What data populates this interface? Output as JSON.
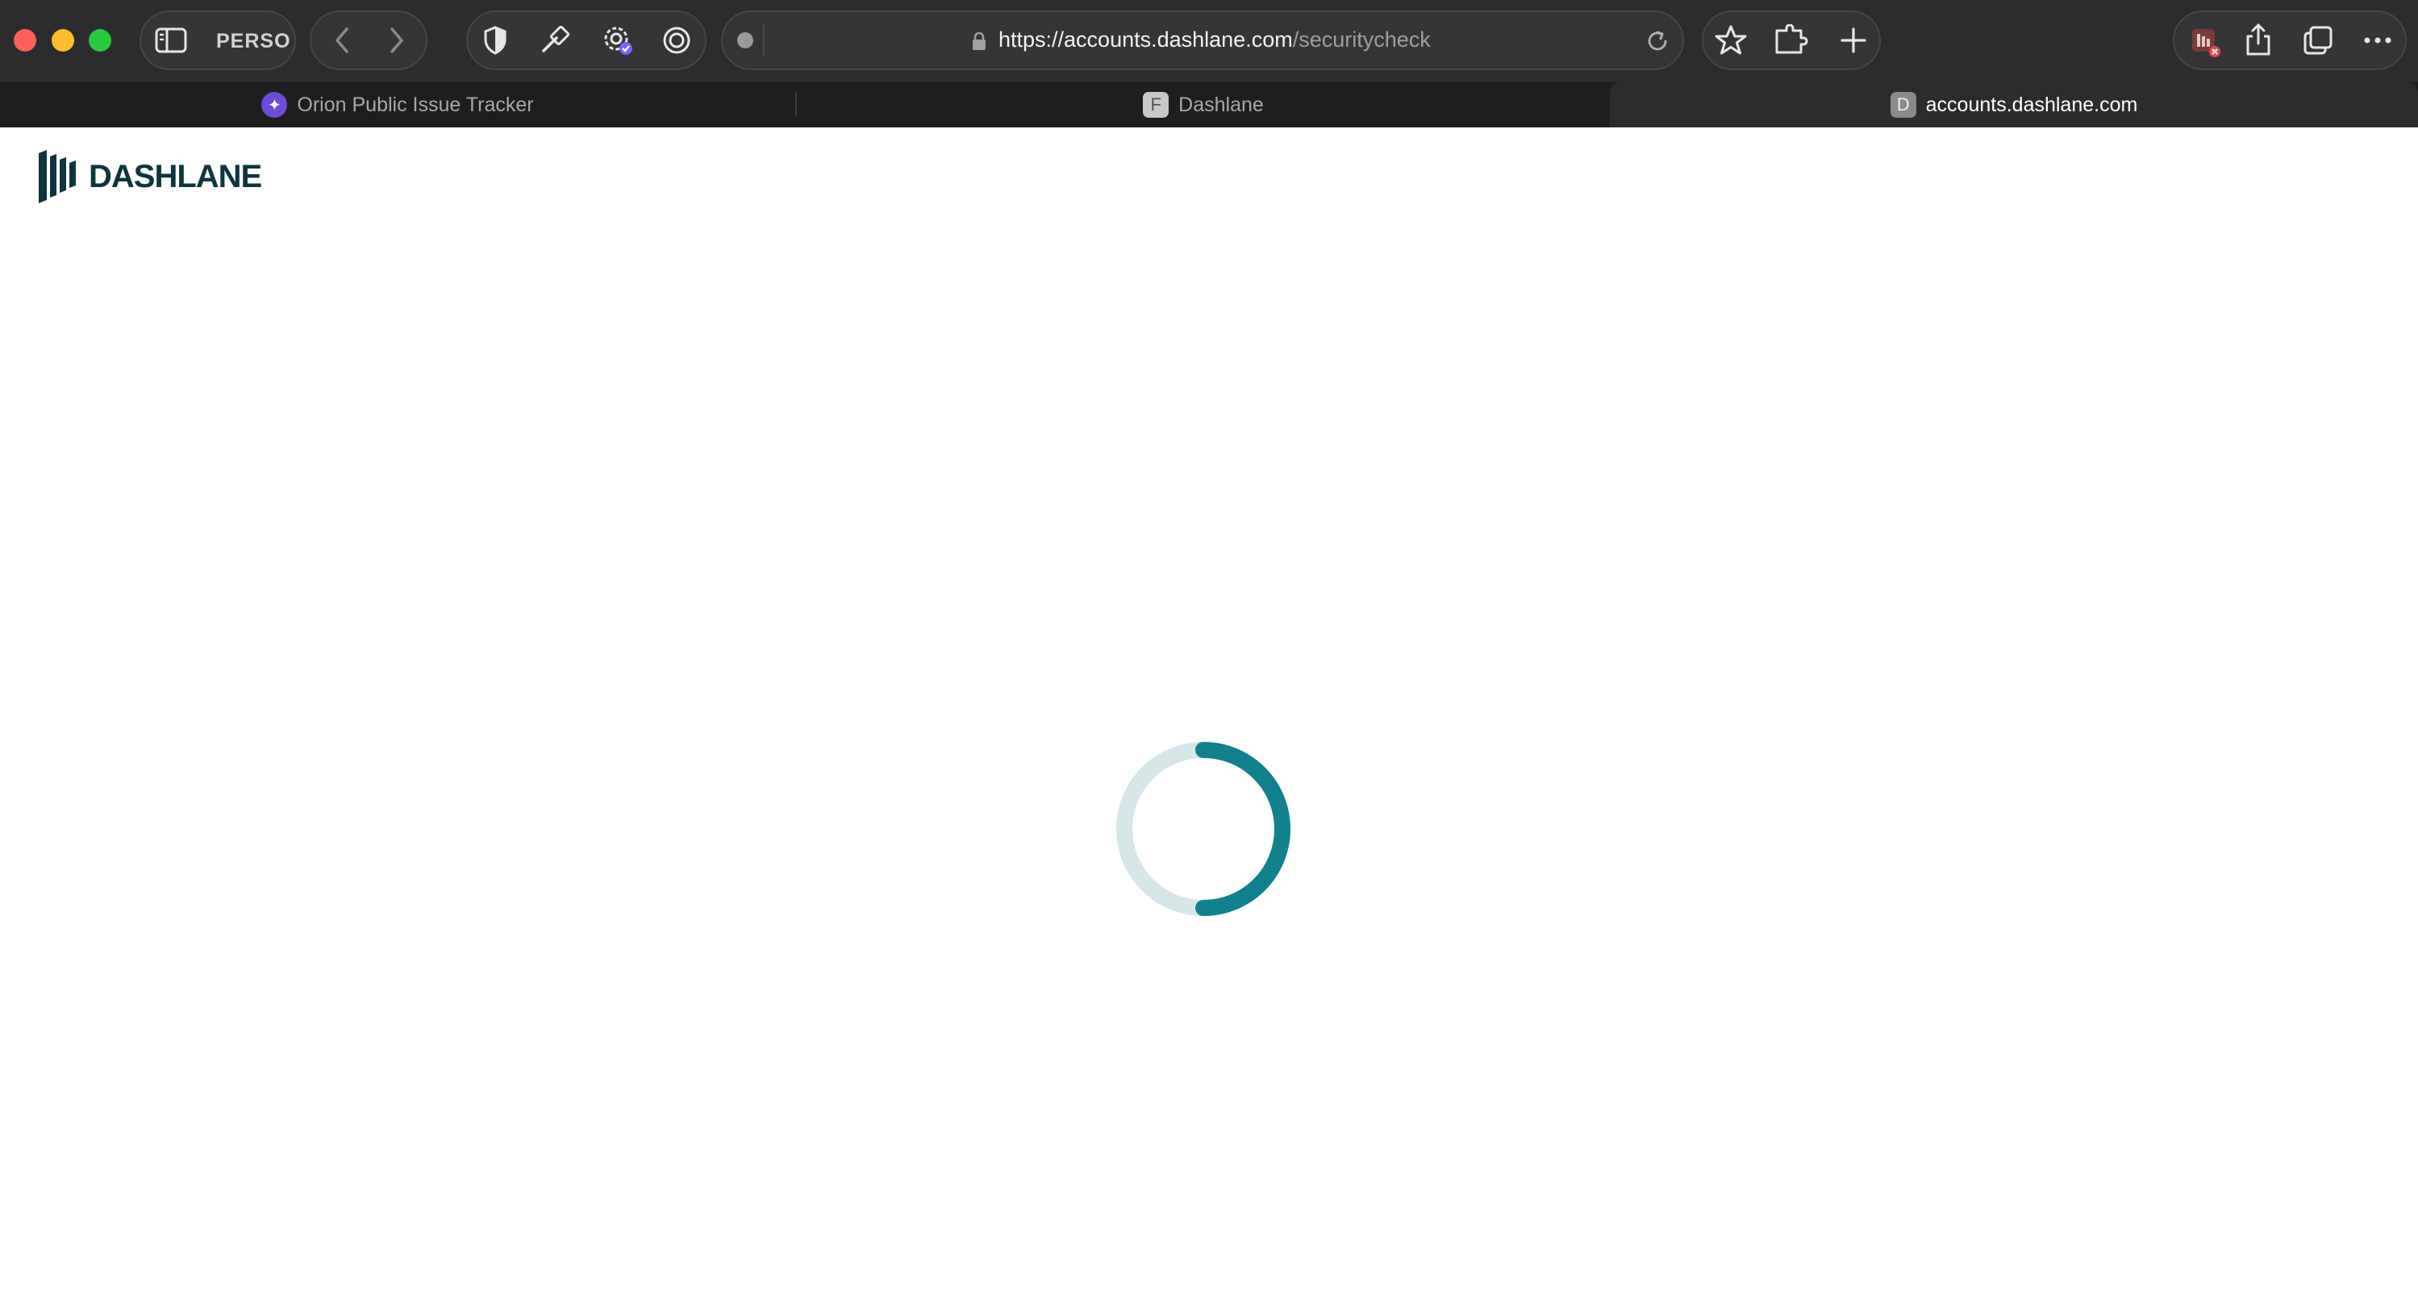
{
  "browser": {
    "profile_label": "PERSO",
    "address_bar": {
      "host": "https://accounts.dashlane.com",
      "path": "/securitycheck"
    },
    "tabs": [
      {
        "label": "Orion Public Issue Tracker",
        "favicon": "orion-icon"
      },
      {
        "label": "Dashlane",
        "favicon": "F"
      },
      {
        "label": "accounts.dashlane.com",
        "favicon": "D",
        "active": true
      }
    ],
    "colors": {
      "close": "#ff5f57",
      "minimize": "#febc2e",
      "maximize": "#28c840",
      "extension_badge": "#e5484d"
    }
  },
  "page": {
    "logo_text": "DASHLANE",
    "brand_color": "#0e353d",
    "spinner": {
      "track_color": "#d6e6e9",
      "arc_color": "#11808f",
      "progress": 0.5
    }
  }
}
